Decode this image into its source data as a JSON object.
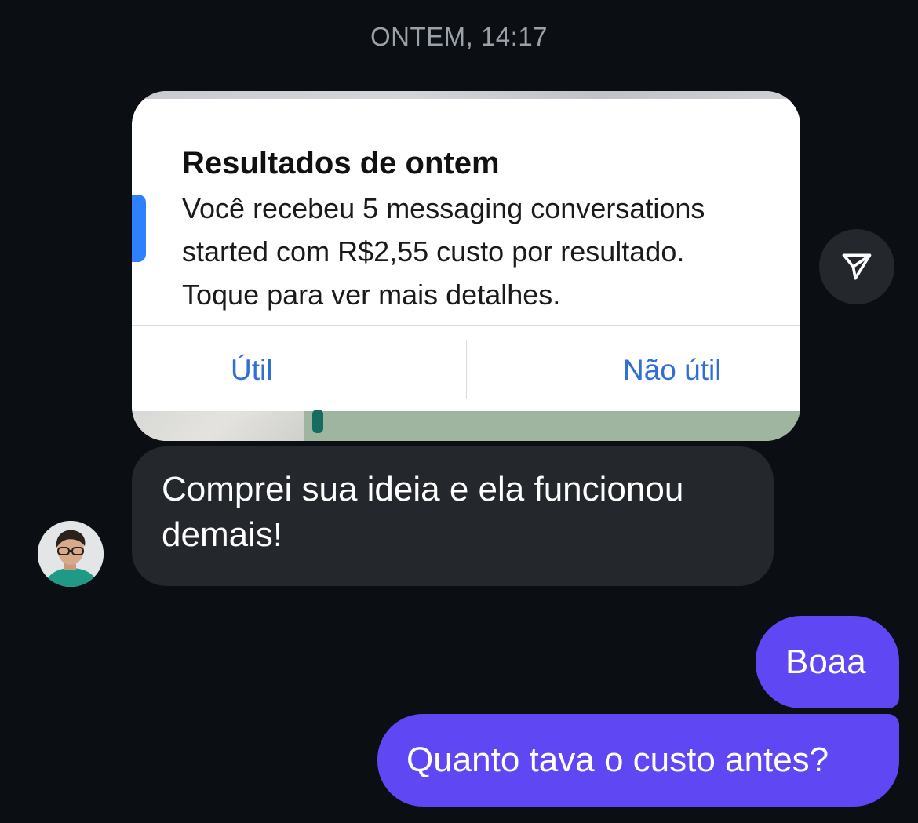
{
  "thread": {
    "timestamp": "ONTEM, 14:17"
  },
  "shared_image": {
    "notification": {
      "title": "Resultados de ontem",
      "body": "Você recebeu 5 messaging conversations\nstarted com R$2,55 custo por resultado.\nToque para ver mais detalhes.",
      "action_useful": "Útil",
      "action_not_useful": "Não útil"
    }
  },
  "share_button": {
    "icon": "send-icon"
  },
  "messages": {
    "received": [
      {
        "text": "Comprei sua ideia e ela funcionou demais!"
      }
    ],
    "sent": [
      {
        "text": "Boaa"
      },
      {
        "text": "Quanto tava o custo antes?"
      }
    ]
  },
  "colors": {
    "background": "#0b0f14",
    "received_bubble": "#24272c",
    "sent_bubble": "#6047f4",
    "link_blue": "#2f6fd6"
  }
}
